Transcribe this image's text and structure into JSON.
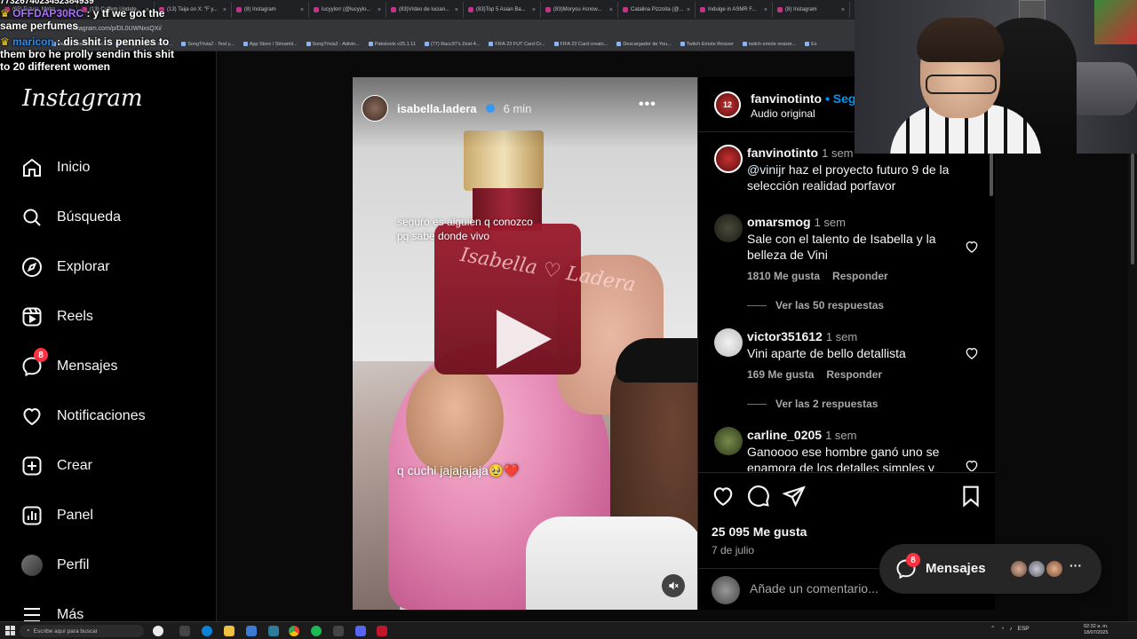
{
  "browser": {
    "tabs": [
      {
        "label": "(65) Future, Metro..."
      },
      {
        "label": "(13) Cuffem Update..."
      },
      {
        "label": "(13) Taija on X: \"F y..."
      },
      {
        "label": "(8) Instagram"
      },
      {
        "label": "lucyylorr (@lucyylo..."
      },
      {
        "label": "(83)Vídeo de lucian..."
      },
      {
        "label": "(83)Top 5 Asian Ba..."
      },
      {
        "label": "(83)Moryou #snow..."
      },
      {
        "label": "Catalina Pizzoita (@..."
      },
      {
        "label": "Indulge in ASMR F..."
      },
      {
        "label": "(8) Instagram"
      }
    ],
    "url": "instagram.com/p/DL0UWNxsQXi/",
    "bookmarks": [
      "Happy Cristiano Ron...",
      "Buraggo figuras de lo...",
      "SongTrivia2 - Test y...",
      "App Store / Streamli...",
      "SongTrivia2 - Adivin...",
      "Pakstools v25.1.11",
      "(77) Racc97's Zest-4...",
      "FIFA 23 FUT Card Cr...",
      "FIFA 23 Card creato...",
      "Descargador de You...",
      "Twitch Emote Resizer",
      "twitch emote resizer...",
      "Es"
    ]
  },
  "chat": {
    "line0": "7732674023452384939",
    "msg1_user": "OFFDAP30RC",
    "msg1_text": " : y tf we got the same perfumes",
    "msg2_user": "maricon",
    "msg2_text": " : dis shit is pennies to them bro he prolly sendin this shit to 20 different women"
  },
  "nav": {
    "logo": "Instagram",
    "items": [
      {
        "label": "Inicio",
        "icon": "home-icon"
      },
      {
        "label": "Búsqueda",
        "icon": "search-icon"
      },
      {
        "label": "Explorar",
        "icon": "compass-icon"
      },
      {
        "label": "Reels",
        "icon": "reels-icon"
      },
      {
        "label": "Mensajes",
        "icon": "messenger-icon",
        "badge": "8"
      },
      {
        "label": "Notificaciones",
        "icon": "heart-icon"
      },
      {
        "label": "Crear",
        "icon": "plus-square-icon"
      },
      {
        "label": "Panel",
        "icon": "chart-icon"
      },
      {
        "label": "Perfil",
        "icon": "avatar"
      },
      {
        "label": "Más",
        "icon": "menu-icon"
      }
    ]
  },
  "video": {
    "username": "isabella.ladera",
    "time": "6 min",
    "overlay_text_1": "seguro es alguien q conozco pq sabe donde vivo",
    "overlay_text_2": "q cuchi jajajajaja🥹❤️",
    "bottle_text": "Isabella ♡ Ladera"
  },
  "post": {
    "author": "fanvinotinto",
    "follow_label": "Seguir",
    "audio": "Audio original",
    "caption_time": "1 sem",
    "caption_mention": "@vinijr",
    "caption_text": " haz el proyecto futuro 9 de la selección realidad porfavor",
    "comments": [
      {
        "user": "omarsmog",
        "time": "1 sem",
        "text": "Sale con el talento de Isabella y la belleza de Vini",
        "likes": "1810 Me gusta",
        "reply": "Responder",
        "replies": "Ver las 50 respuestas"
      },
      {
        "user": "victor351612",
        "time": "1 sem",
        "text": "Vini aparte de bello detallista",
        "likes": "169 Me gusta",
        "reply": "Responder",
        "replies": "Ver las 2 respuestas"
      },
      {
        "user": "carline_0205",
        "time": "1 sem",
        "text": "Ganoooo ese hombre ganó uno se enamora de los detalles simples y"
      }
    ],
    "likes_total": "25 095 Me gusta",
    "date": "7 de julio",
    "comment_placeholder": "Añade un comentario..."
  },
  "messages_pill": {
    "label": "Mensajes",
    "badge": "8"
  },
  "taskbar": {
    "search_placeholder": "Escribe aquí para buscar",
    "lang": "ESP",
    "time": "02:32 a. m.",
    "date": "18/07/2025"
  },
  "colors": {
    "accent_blue": "#0095f6",
    "badge_red": "#ff3040",
    "chat_purple": "#a970ff",
    "chat_blue": "#1e90ff"
  }
}
